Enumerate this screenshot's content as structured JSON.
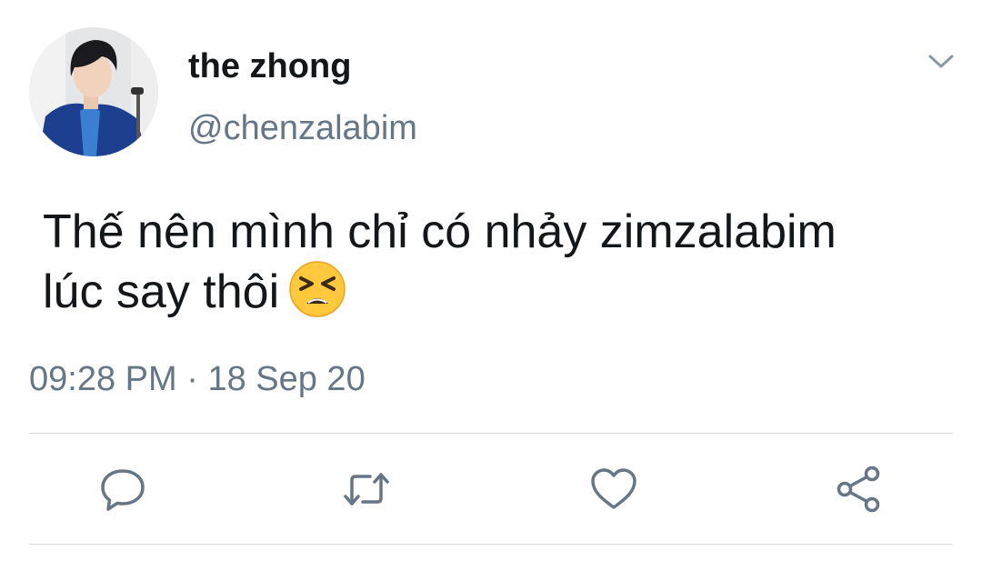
{
  "user": {
    "display_name": "the zhong",
    "handle": "@chenzalabim"
  },
  "tweet": {
    "text_lines": [
      "Thế nên mình chỉ có nhảy zimzalabim",
      "lúc say thôi"
    ],
    "emoji": "persevering-face",
    "time": "09:28 PM",
    "separator": "·",
    "date": "18 Sep 20"
  },
  "actions": [
    "reply-icon",
    "retweet-icon",
    "like-icon",
    "share-icon"
  ],
  "colors": {
    "text": "#14171a",
    "secondary": "#657786",
    "divider": "#d6dbdf",
    "icon": "#657786"
  }
}
